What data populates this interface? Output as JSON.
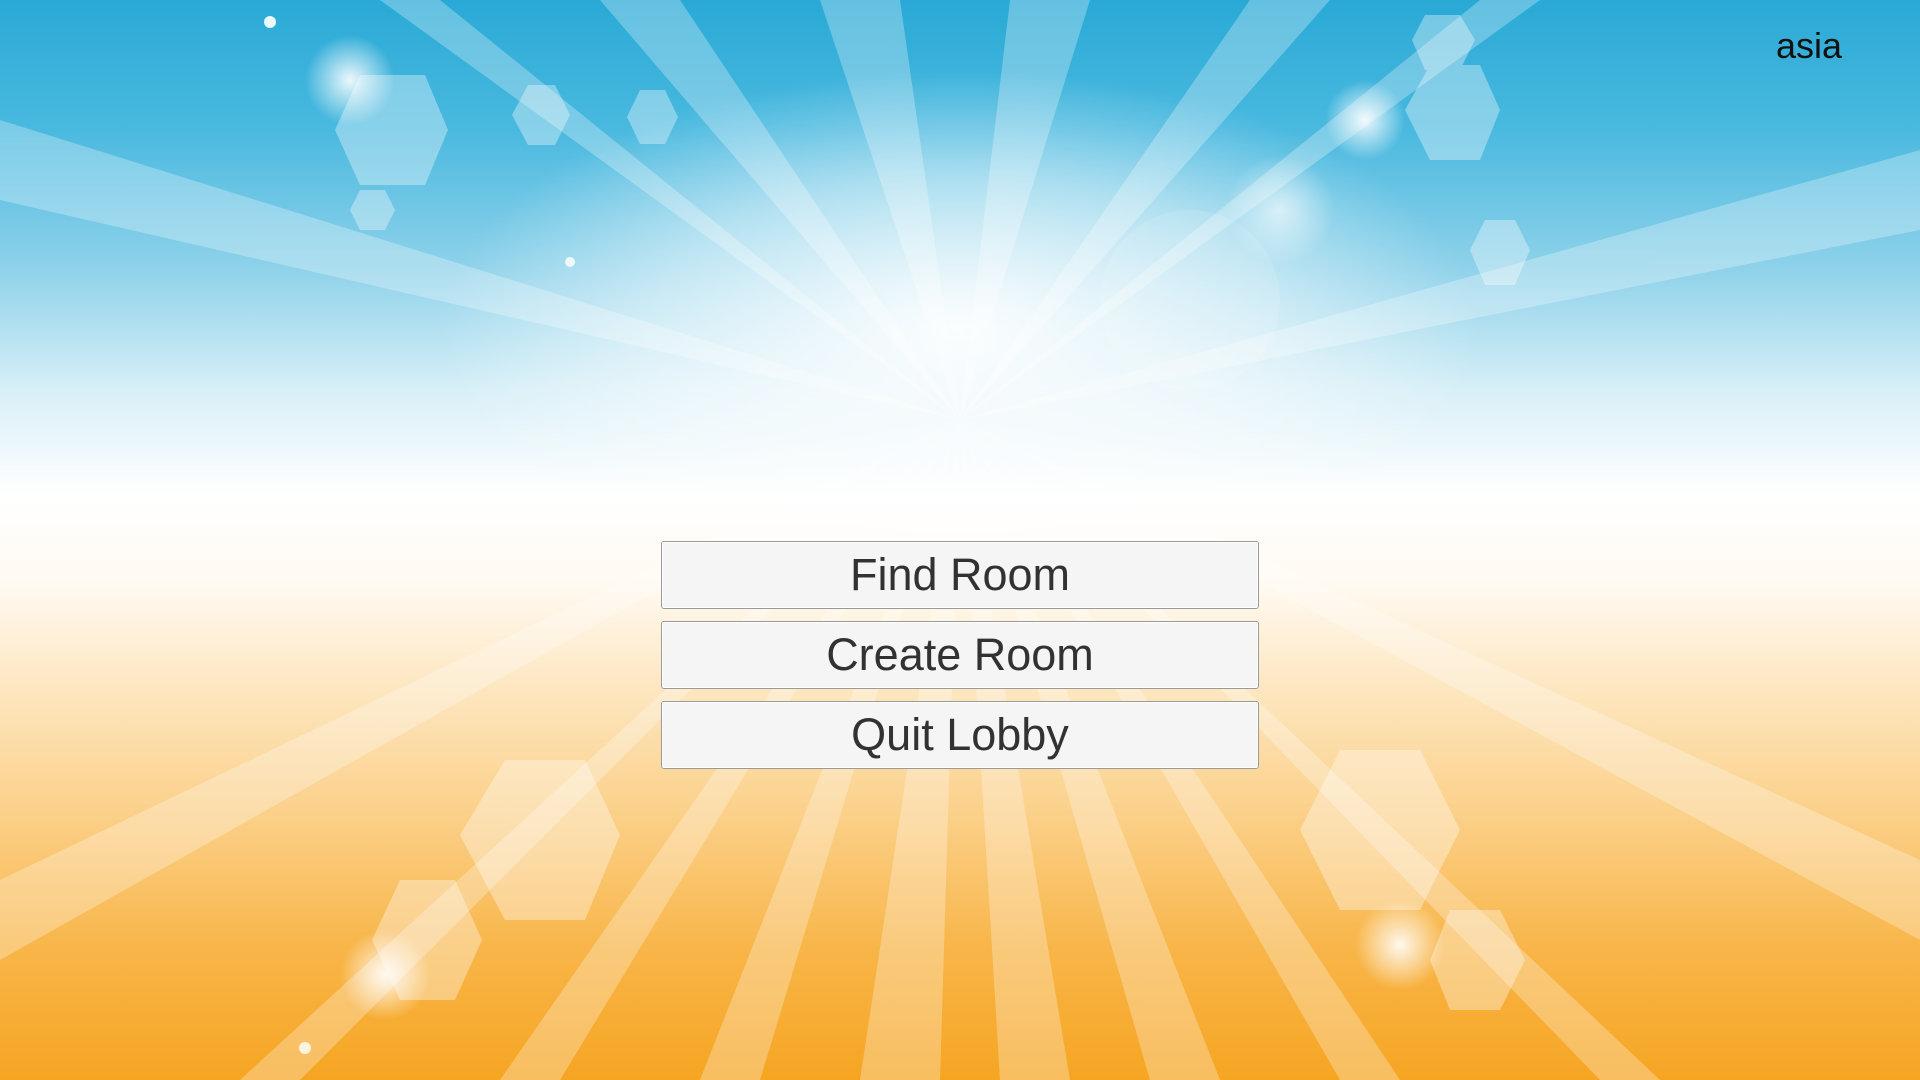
{
  "header": {
    "region": "asia"
  },
  "menu": {
    "find_room_label": "Find Room",
    "create_room_label": "Create Room",
    "quit_lobby_label": "Quit Lobby"
  },
  "colors": {
    "sky_blue": "#29a9d6",
    "sun_orange": "#f6a522",
    "button_bg": "#f5f5f5",
    "button_text": "#323232"
  }
}
